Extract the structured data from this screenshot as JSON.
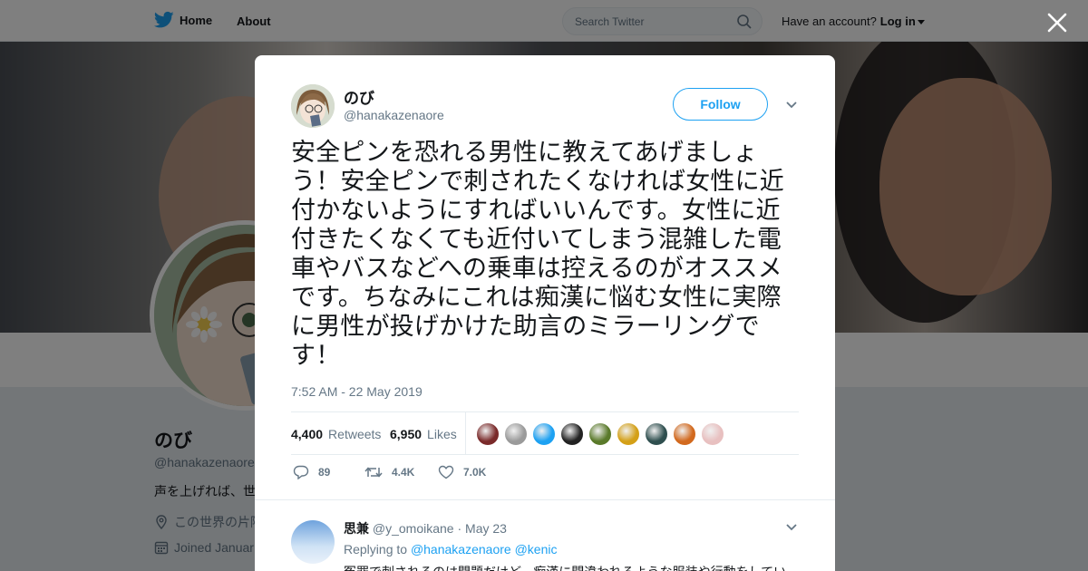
{
  "nav": {
    "home_label": "Home",
    "about_label": "About",
    "search_placeholder": "Search Twitter",
    "account_prompt": "Have an account?",
    "login_label": "Log in"
  },
  "profile": {
    "name": "のび",
    "handle": "@hanakazenaore",
    "bio_partial": "声を上げれば、世",
    "location_partial": "この世界の片隅",
    "joined_partial": "Joined Januar"
  },
  "tweet": {
    "author_name": "のび",
    "author_handle": "@hanakazenaore",
    "follow_label": "Follow",
    "text": "安全ピンを恐れる男性に教えてあげましょう！安全ピンで刺されたくなければ女性に近付かないようにすればいいんです。女性に近付きたくなくても近付いてしまう混雑した電車やバスなどへの乗車は控えるのがオススメです。ちなみにこれは痴漢に悩む女性に実際に男性が投げかけた助言のミラーリングです！",
    "timestamp": "7:52 AM - 22 May 2019",
    "retweets_count": "4,400",
    "retweets_label": "Retweets",
    "likes_count": "6,950",
    "likes_label": "Likes",
    "reply_count": "89",
    "retweet_action_count": "4.4K",
    "like_action_count": "7.0K",
    "liker_colors": [
      "#7a2a2a",
      "#9a9a9a",
      "#1da1f2",
      "#222222",
      "#5a7a2a",
      "#d4a017",
      "#2f4f4f",
      "#d2691e",
      "#e8c0c0"
    ]
  },
  "reply": {
    "author_name": "思兼",
    "author_handle": "@y_omoikane",
    "separator": "·",
    "date": "May 23",
    "replying_prefix": "Replying to",
    "mention_1": "@hanakazenaore",
    "mention_2": "@kenic",
    "text_partial": "冤罪で刺されるのは問題だけど、痴漢に間違われるような服装や行動をしてい"
  },
  "colors": {
    "accent": "#1da1f2",
    "muted": "#657786",
    "text": "#14171a"
  }
}
